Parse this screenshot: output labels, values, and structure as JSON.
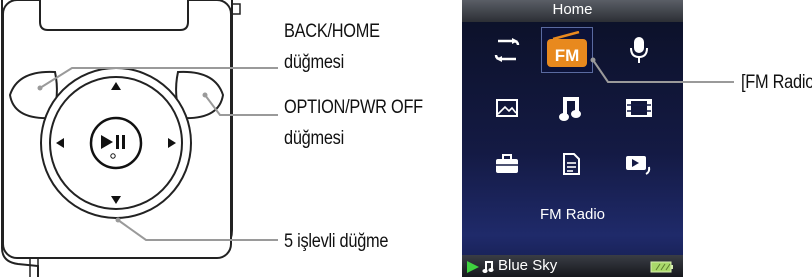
{
  "callouts": {
    "back_home_line1": "BACK/HOME",
    "back_home_line2": "düğmesi",
    "option_line1": "OPTION/PWR OFF",
    "option_line2": "düğmesi",
    "five_way": "5 işlevli düğme",
    "fm_radio": "[FM Radio]"
  },
  "screen": {
    "title": "Home",
    "fm_label": "FM",
    "selected_label": "FM Radio",
    "now_playing": "Blue Sky",
    "icons": [
      "shuffle-icon",
      "fm-radio-icon",
      "microphone-icon",
      "photo-icon",
      "music-note-icon",
      "video-icon",
      "settings-toolbox-icon",
      "playlist-document-icon",
      "now-playing-icon"
    ]
  },
  "colors": {
    "screen_bg": "#141a44",
    "fm_accent": "#e8891e",
    "play_indicator": "#3fd23f",
    "battery": "#a9d86a"
  }
}
